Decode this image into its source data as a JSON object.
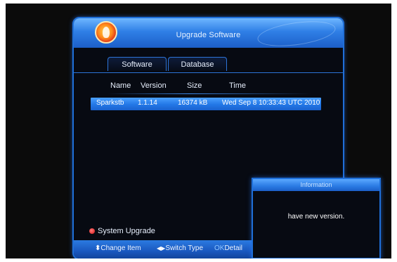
{
  "window": {
    "title": "Upgrade Software"
  },
  "tabs": [
    {
      "label": "Software"
    },
    {
      "label": "Database"
    }
  ],
  "table": {
    "columns": [
      "Name",
      "Version",
      "Size",
      "Time"
    ],
    "rows": [
      {
        "name": "Sparkstb",
        "version": "1.1.14",
        "size": "16374 kB",
        "time": "Wed Sep  8 10:33:43 UTC 2010"
      }
    ]
  },
  "actions": {
    "system_upgrade": "System Upgrade"
  },
  "footer": {
    "change_item_key": "⬍",
    "change_item": "Change Item",
    "switch_type_key": "◀▶",
    "switch_type": "Switch Type",
    "detail_key": "OK",
    "detail": "Detail"
  },
  "dialog": {
    "title": "Information",
    "message": "have new version."
  },
  "colors": {
    "accent": "#2377e6",
    "background": "#0b0b0b",
    "red_button": "#d41313"
  },
  "icons": {
    "logo": "swirl-logo-icon",
    "red_button": "red-key-icon"
  }
}
